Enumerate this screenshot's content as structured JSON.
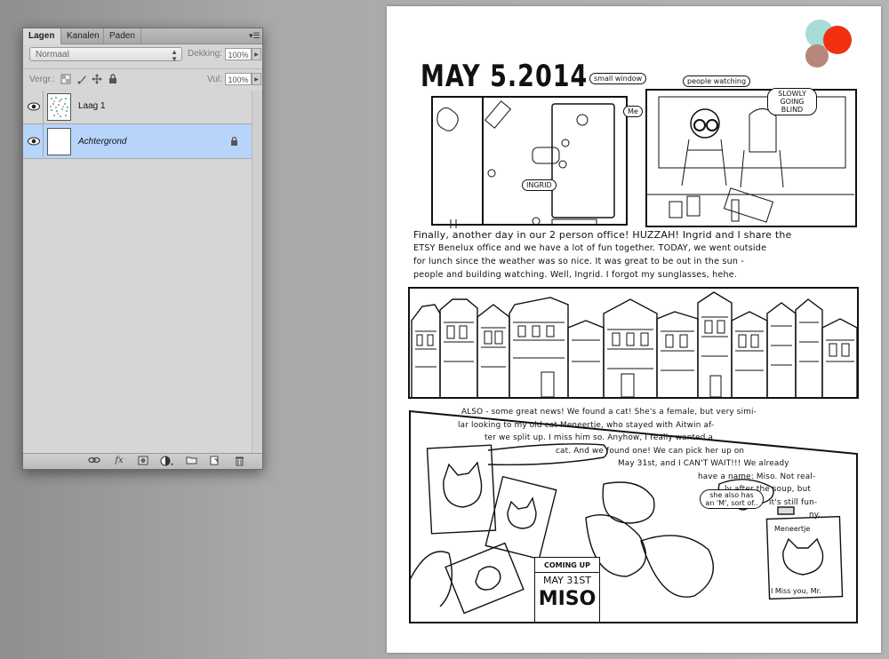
{
  "panel": {
    "tabs": [
      "Lagen",
      "Kanalen",
      "Paden"
    ],
    "menu_icon": "panel-menu-icon",
    "blend_mode": "Normaal",
    "opacity_label": "Dekking:",
    "opacity_value": "100%",
    "lock_label": "Vergr.:",
    "fill_label": "Vul:",
    "fill_value": "100%",
    "layers": [
      {
        "name": "Laag 1",
        "visible": true,
        "selected": false
      },
      {
        "name": "Achtergrond",
        "visible": true,
        "selected": true,
        "locked": true
      }
    ],
    "bottom_icons": [
      "link-layers-icon",
      "fx-icon",
      "mask-icon",
      "adjustment-icon",
      "folder-icon",
      "new-layer-icon",
      "trash-icon"
    ],
    "fx_label": "fx"
  },
  "document": {
    "title": "MAY 5.2014",
    "bubbles": {
      "small_window": "small window",
      "people_watching": "people watching",
      "slowly_blind": "SLOWLY GOING BLIND",
      "me": "Me",
      "ingrid": "INGRID"
    },
    "paragraph1": [
      "Finally, another day in our 2 person office! HUZZAH! Ingrid and I share the",
      "ETSY Benelux office and we have a lot of fun together. TODAY, we went outside",
      "for lunch since the weather was so nice. It was great to be out in the sun -",
      "people and building watching. Well, Ingrid. I forgot my sunglasses, hehe."
    ],
    "paragraph2": [
      "ALSO - some great news! We found a cat! She's a female, but very simi-",
      "lar looking to my old cat Meneertje, who stayed with Aitwin af-",
      "ter we split up. I miss him so. Anyhow, I really wanted a",
      "cat. And we found one! We can pick her up on",
      "May 31st, and I CAN'T WAIT!!! We already",
      "have a name: Miso. Not real-",
      "ly after the soup, but",
      "it's still fun-",
      "ny."
    ],
    "she_bubble": "she also has an 'M', sort of..",
    "coming_up": "COMING UP",
    "date": "MAY 31ST",
    "name": "MISO",
    "frame_label": "Meneertje",
    "miss_you": "I Miss you, Mr."
  },
  "colors": {
    "selected_layer": "#b7d5fb",
    "panel_bg": "#d6d6d6",
    "dot_teal": "#a6ddd7",
    "dot_red": "#f03010",
    "dot_brown": "#b8867a"
  }
}
